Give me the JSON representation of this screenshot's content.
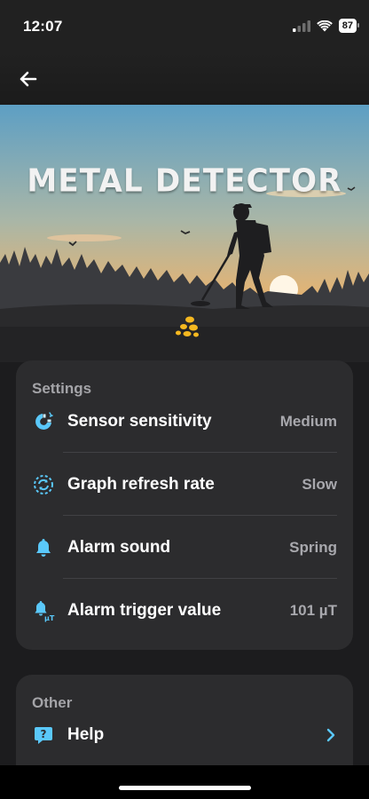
{
  "status": {
    "time": "12:07",
    "battery": "87"
  },
  "hero": {
    "title": "METAL DETECTOR"
  },
  "settings": {
    "title": "Settings",
    "items": [
      {
        "label": "Sensor sensitivity",
        "value": "Medium",
        "icon": "magnet-icon"
      },
      {
        "label": "Graph refresh rate",
        "value": "Slow",
        "icon": "refresh-icon"
      },
      {
        "label": "Alarm sound",
        "value": "Spring",
        "icon": "bell-icon"
      },
      {
        "label": "Alarm trigger value",
        "value": "101 µT",
        "icon": "bell-microtesla-icon",
        "icon_badge": "µT"
      }
    ]
  },
  "other": {
    "title": "Other",
    "items": [
      {
        "label": "Help",
        "icon": "help-icon"
      }
    ]
  },
  "colors": {
    "accent": "#5ac8fa",
    "card": "#2c2c2e",
    "background": "#1c1c1e",
    "value_text": "#a8a8ad"
  }
}
